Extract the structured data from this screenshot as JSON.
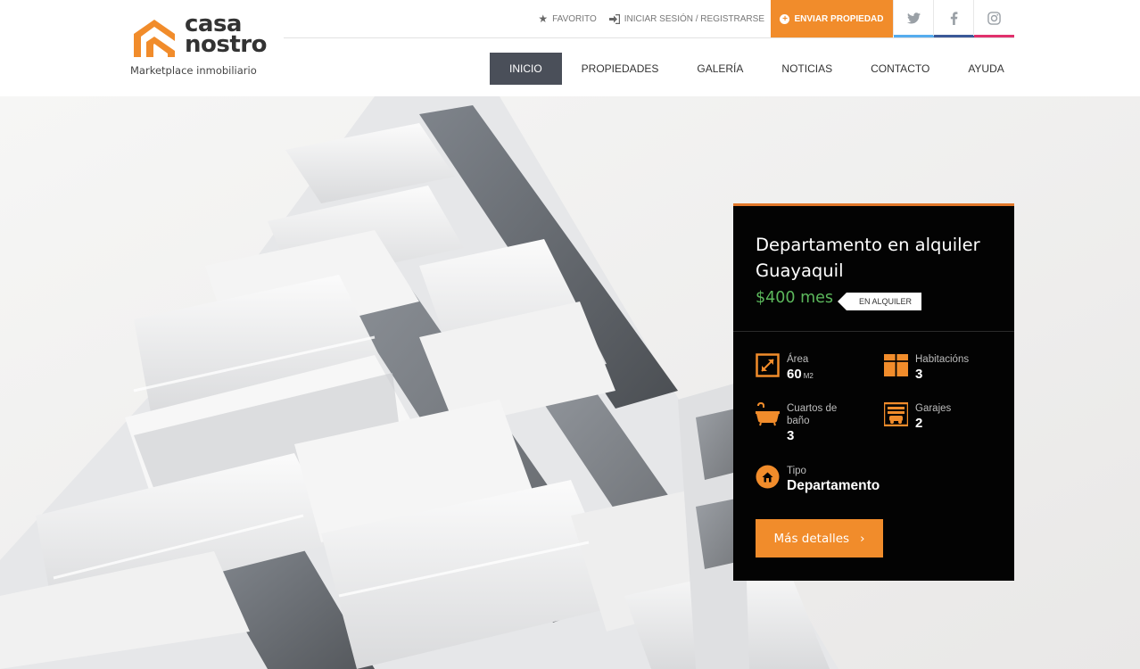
{
  "brand": {
    "name_line1": "casa",
    "name_line2": "nostro",
    "tagline": "Marketplace inmobiliario",
    "accent_color": "#f18c2b"
  },
  "topbar": {
    "favorite_label": "FAVORITO",
    "login_label": "INICIAR SESIÓN / REGISTRARSE",
    "send_property_label": "ENVIAR PROPIEDAD",
    "social": [
      "twitter-icon",
      "facebook-icon",
      "instagram-icon"
    ]
  },
  "nav": {
    "items": [
      "INICIO",
      "PROPIEDADES",
      "GALERÍA",
      "NOTICIAS",
      "CONTACTO",
      "AYUDA"
    ],
    "active": "INICIO"
  },
  "card": {
    "title_line1": "Departamento en alquiler",
    "title_line2": "Guayaquil",
    "price": "$400 mes",
    "badge": "EN ALQUILER",
    "area_label": "Área",
    "area_value": "60",
    "area_unit": "M2",
    "rooms_label": "Habitacións",
    "rooms_value": "3",
    "bath_label_line1": "Cuartos de",
    "bath_label_line2": "baño",
    "bath_value": "3",
    "garage_label": "Garajes",
    "garage_value": "2",
    "type_label": "Tipo",
    "type_value": "Departamento",
    "details_button": "Más detalles",
    "price_color": "#5cb85c"
  }
}
